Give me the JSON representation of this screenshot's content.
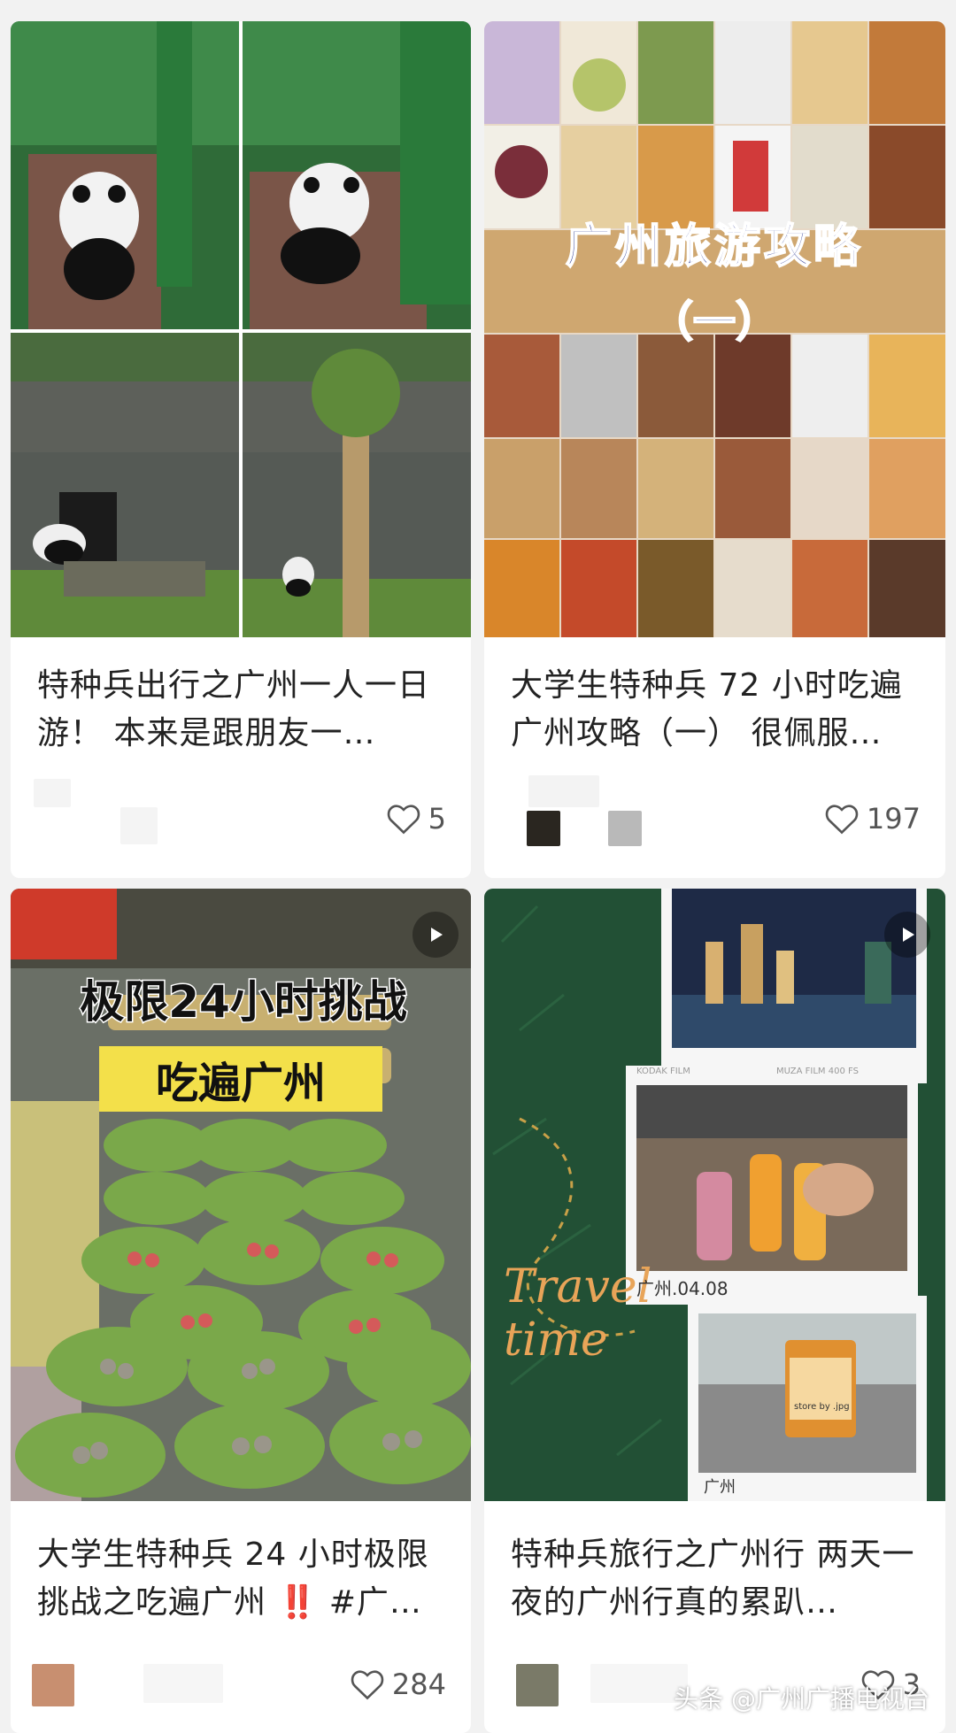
{
  "feed": {
    "cards": [
      {
        "title": "特种兵出行之广州一人一日游！ 本来是跟朋友一…",
        "likes": "5",
        "image_desc": "panda-photo-grid"
      },
      {
        "title": "大学生特种兵 72 小时吃遍广州攻略（一） 很佩服…",
        "likes": "197",
        "image_overlay_title": "广州旅游攻略",
        "image_overlay_sub": "（一）"
      },
      {
        "title": "大学生特种兵 24 小时极限挑战之吃遍广州 ‼️ #广…",
        "likes": "284",
        "image_overlay_title": "极限24小时挑战",
        "image_overlay_sub": "吃遍广州"
      },
      {
        "title": "特种兵旅行之广州行 两天一夜的广州行真的累趴…",
        "likes": "3",
        "image_overlay_title": "Travel time",
        "film_label_1": "KODAK FILM",
        "film_label_2": "MUZA FILM 400 FS",
        "film_date": "广州.04.08",
        "film_caption": "广州",
        "cup_label": "store by .jpg"
      }
    ]
  },
  "watermark": "头条 @广州广播电视台",
  "colors": {
    "background": "#f2f2f2",
    "card": "#ffffff",
    "text": "#222222",
    "likes": "#555555"
  }
}
